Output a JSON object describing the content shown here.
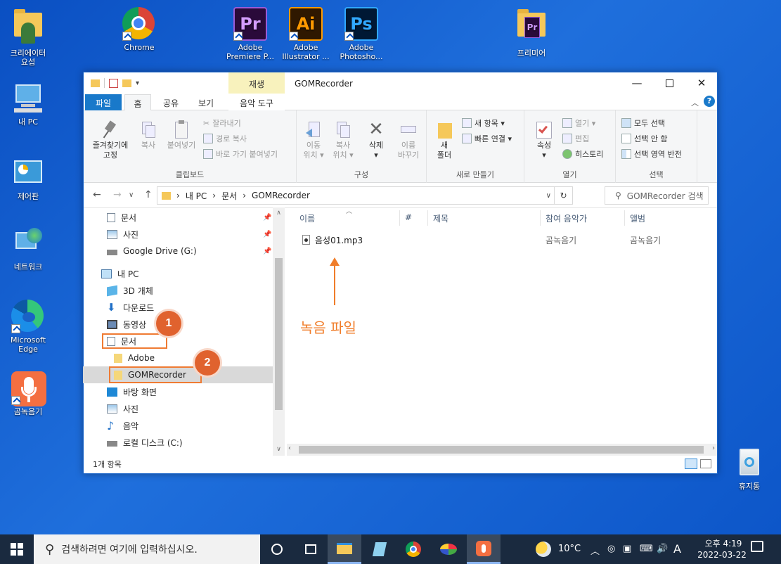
{
  "desktop": {
    "icons": [
      {
        "label": "크리에이터\n요섭"
      },
      {
        "label": "Chrome"
      },
      {
        "label": "Adobe\nPremiere P..."
      },
      {
        "label": "Adobe\nIllustrator ..."
      },
      {
        "label": "Adobe\nPhotosho..."
      },
      {
        "label": "프리미어"
      },
      {
        "label": "내 PC"
      },
      {
        "label": "제어판"
      },
      {
        "label": "네트워크"
      },
      {
        "label": "Microsoft\nEdge"
      },
      {
        "label": "곰녹음기"
      },
      {
        "label": "휴지통"
      }
    ],
    "adobe": {
      "pr": "Pr",
      "ai": "Ai",
      "ps": "Ps",
      "pr2": "Pr"
    }
  },
  "window": {
    "title": "GOMRecorder",
    "context_tab": "재생",
    "context_group": "음악 도구",
    "tabs": [
      "파일",
      "홈",
      "공유",
      "보기"
    ],
    "help": "?",
    "ribbon": {
      "clipboard": {
        "name": "클립보드",
        "pin": "즐겨찾기에\n고정",
        "copy": "복사",
        "paste": "붙여넣기",
        "cut": "잘라내기",
        "copy_path": "경로 복사",
        "paste_shortcut": "바로 가기 붙여넣기"
      },
      "organize": {
        "name": "구성",
        "move": "이동\n위치 ▾",
        "copy_to": "복사\n위치 ▾",
        "delete": "삭제\n▾",
        "rename": "이름\n바꾸기"
      },
      "new": {
        "name": "새로 만들기",
        "new_folder": "새\n폴더",
        "new_item": "새 항목 ▾",
        "easy_access": "빠른 연결 ▾"
      },
      "open": {
        "name": "열기",
        "properties": "속성\n▾",
        "open": "열기 ▾",
        "edit": "편집",
        "history": "히스토리"
      },
      "select": {
        "name": "선택",
        "select_all": "모두 선택",
        "select_none": "선택 안 함",
        "invert": "선택 영역 반전"
      }
    },
    "address": {
      "segments": [
        "내 PC",
        "문서",
        "GOMRecorder"
      ],
      "search_placeholder": "GOMRecorder 검색"
    },
    "nav": [
      {
        "label": "문서",
        "pinned": true
      },
      {
        "label": "사진",
        "pinned": true
      },
      {
        "label": "Google Drive (G:)",
        "pinned": true
      },
      {
        "label": "내 PC"
      },
      {
        "label": "3D 개체"
      },
      {
        "label": "다운로드"
      },
      {
        "label": "동영상"
      },
      {
        "label": "문서"
      },
      {
        "label": "Adobe"
      },
      {
        "label": "GOMRecorder"
      },
      {
        "label": "바탕 화면"
      },
      {
        "label": "사진"
      },
      {
        "label": "음악"
      },
      {
        "label": "로컬 디스크 (C:)"
      }
    ],
    "columns": [
      "이름",
      "#",
      "제목",
      "참여 음악가",
      "앨범"
    ],
    "files": [
      {
        "name": "음성01.mp3",
        "num": "",
        "title": "",
        "artist": "곰녹음기",
        "album": "곰녹음기"
      }
    ],
    "status": "1개 항목"
  },
  "annotations": {
    "badge1": "1",
    "badge2": "2",
    "label": "녹음 파일"
  },
  "taskbar": {
    "search": "검색하려면 여기에 입력하십시오.",
    "weather": "10°C",
    "ime": "A",
    "time": "오후 4:19",
    "date": "2022-03-22"
  },
  "colors": {
    "desktop": "#0c55c8",
    "accent": "#1979ca",
    "annotation": "#f07d2a",
    "badge": "#e0622e"
  }
}
